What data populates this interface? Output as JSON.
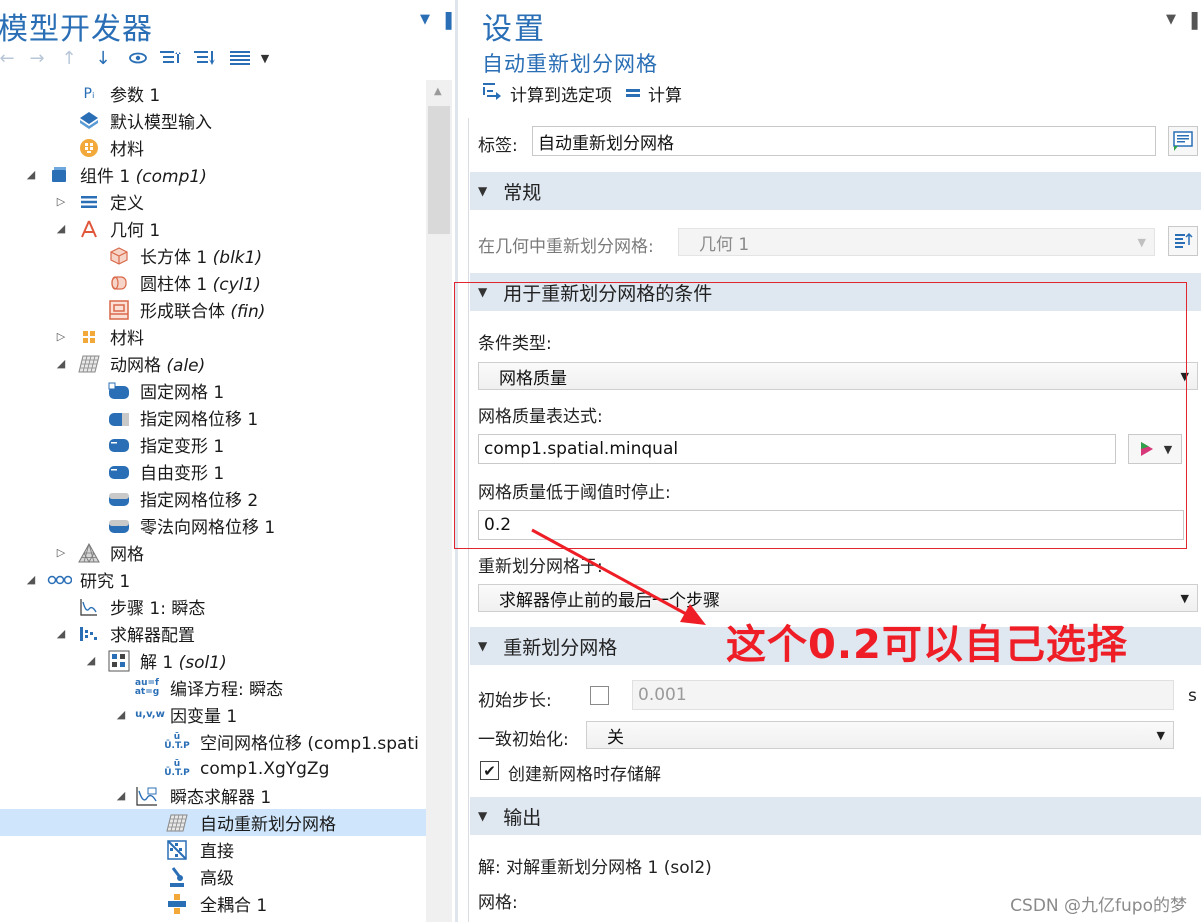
{
  "left_panel": {
    "title": "模型开发器",
    "tree": [
      {
        "label": "参数 1",
        "suffix": "",
        "icon": "pi-icon"
      },
      {
        "label": "默认模型输入",
        "suffix": "",
        "icon": "model-input-icon"
      },
      {
        "label": "材料",
        "suffix": "",
        "icon": "materials-global-icon"
      },
      {
        "label": "组件 1",
        "suffix": "(comp1)",
        "icon": "component-icon"
      },
      {
        "label": "定义",
        "suffix": "",
        "icon": "definitions-icon"
      },
      {
        "label": "几何 1",
        "suffix": "",
        "icon": "geometry-icon"
      },
      {
        "label": "长方体 1",
        "suffix": "(blk1)",
        "icon": "block-icon"
      },
      {
        "label": "圆柱体 1",
        "suffix": "(cyl1)",
        "icon": "cylinder-icon"
      },
      {
        "label": "形成联合体",
        "suffix": "(fin)",
        "icon": "form-union-icon"
      },
      {
        "label": "材料",
        "suffix": "",
        "icon": "materials-icon"
      },
      {
        "label": "动网格",
        "suffix": "(ale)",
        "icon": "moving-mesh-icon"
      },
      {
        "label": "固定网格 1",
        "suffix": "",
        "icon": "fixed-mesh-icon"
      },
      {
        "label": "指定网格位移 1",
        "suffix": "",
        "icon": "prescribed-displacement-icon"
      },
      {
        "label": "指定变形 1",
        "suffix": "",
        "icon": "prescribed-deformation-icon"
      },
      {
        "label": "自由变形 1",
        "suffix": "",
        "icon": "free-deformation-icon"
      },
      {
        "label": "指定网格位移 2",
        "suffix": "",
        "icon": "prescribed-displacement-icon"
      },
      {
        "label": "零法向网格位移 1",
        "suffix": "",
        "icon": "zero-normal-displacement-icon"
      },
      {
        "label": "网格",
        "suffix": "",
        "icon": "mesh-icon"
      },
      {
        "label": "研究 1",
        "suffix": "",
        "icon": "study-icon"
      },
      {
        "label": "步骤 1: 瞬态",
        "suffix": "",
        "icon": "time-dependent-step-icon"
      },
      {
        "label": "求解器配置",
        "suffix": "",
        "icon": "solver-configurations-icon"
      },
      {
        "label": "解 1",
        "suffix": "(sol1)",
        "icon": "solution-icon"
      },
      {
        "label": "编译方程: 瞬态",
        "suffix": "",
        "icon": "compile-equations-icon"
      },
      {
        "label": "因变量 1",
        "suffix": "",
        "icon": "dependent-variables-icon"
      },
      {
        "label": "空间网格位移 (comp1.spati",
        "suffix": "",
        "icon": "field-variable-icon"
      },
      {
        "label": "comp1.XgYgZg",
        "suffix": "",
        "icon": "field-variable-icon"
      },
      {
        "label": "瞬态求解器 1",
        "suffix": "",
        "icon": "time-dependent-solver-icon"
      },
      {
        "label": "自动重新划分网格",
        "suffix": "",
        "icon": "automatic-remeshing-icon"
      },
      {
        "label": "直接",
        "suffix": "",
        "icon": "direct-solver-icon"
      },
      {
        "label": "高级",
        "suffix": "",
        "icon": "advanced-icon"
      },
      {
        "label": "全耦合 1",
        "suffix": "",
        "icon": "fully-coupled-icon"
      }
    ]
  },
  "settings": {
    "title": "设置",
    "subtitle": "自动重新划分网格",
    "actions": {
      "compute_to_selected": "计算到选定项",
      "compute": "计算"
    },
    "label_field": {
      "label": "标签:",
      "value": "自动重新划分网格"
    },
    "general": {
      "header": "常规",
      "remesh_in_geometry_label": "在几何中重新划分网格:",
      "remesh_in_geometry_value": "几何 1"
    },
    "condition": {
      "header": "用于重新划分网格的条件",
      "condition_type_label": "条件类型:",
      "condition_type_value": "网格质量",
      "quality_expr_label": "网格质量表达式:",
      "quality_expr_value": "comp1.spatial.minqual",
      "stop_below_label": "网格质量低于阈值时停止:",
      "stop_below_value": "0.2",
      "remesh_at_label": "重新划分网格于:",
      "remesh_at_value": "求解器停止前的最后一个步骤"
    },
    "remeshing": {
      "header": "重新划分网格",
      "initial_step_label": "初始步长:",
      "initial_step_value": "0.001",
      "initial_step_unit": "s",
      "consistent_init_label": "一致初始化:",
      "consistent_init_value": "关",
      "store_solution_label": "创建新网格时存储解",
      "store_solution_checked": true
    },
    "output": {
      "header": "输出",
      "solution_line": "解:  对解重新划分网格 1 (sol2)",
      "mesh_label": "网格:"
    }
  },
  "annotation": {
    "text": "这个0.2可以自己选择",
    "color": "#ee1d26"
  },
  "watermark": "CSDN @九亿fupo的梦",
  "colors": {
    "accent": "#2a6fb6",
    "section_header": "#dfe7f1",
    "selection": "#cfe5fb",
    "annotation_red": "#e0262f"
  }
}
